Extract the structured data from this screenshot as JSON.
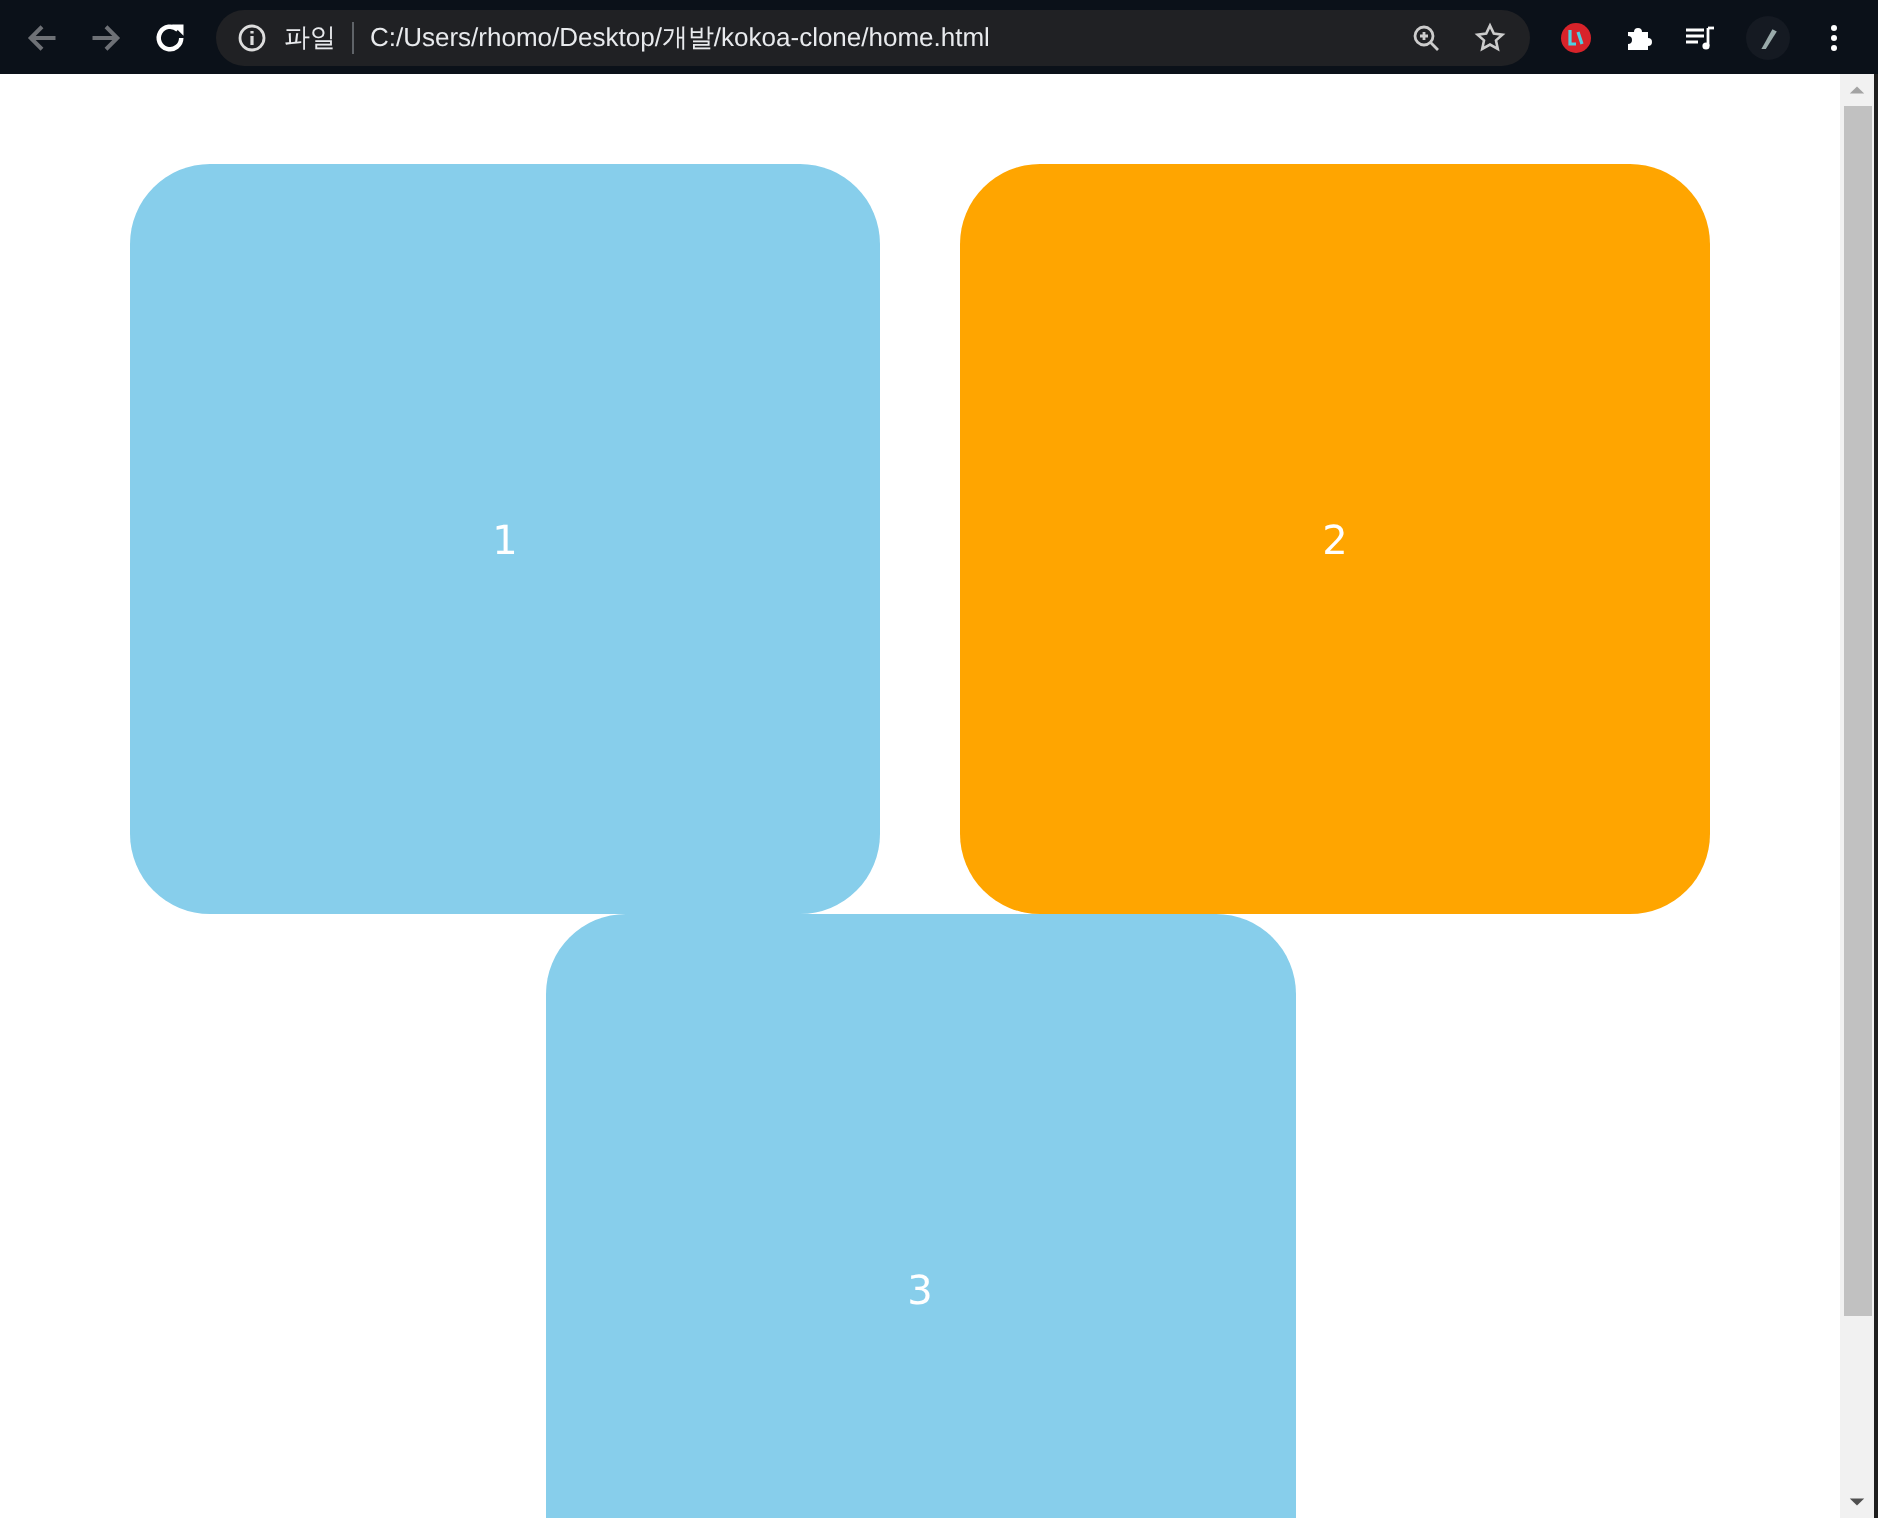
{
  "browser": {
    "origin_label": "파일",
    "url": "C:/Users/rhomo/Desktop/개발/kokoa-clone/home.html"
  },
  "boxes": [
    {
      "label": "1",
      "color": "#87ceeb"
    },
    {
      "label": "2",
      "color": "#ffa500"
    },
    {
      "label": "3",
      "color": "#87ceeb"
    }
  ]
}
